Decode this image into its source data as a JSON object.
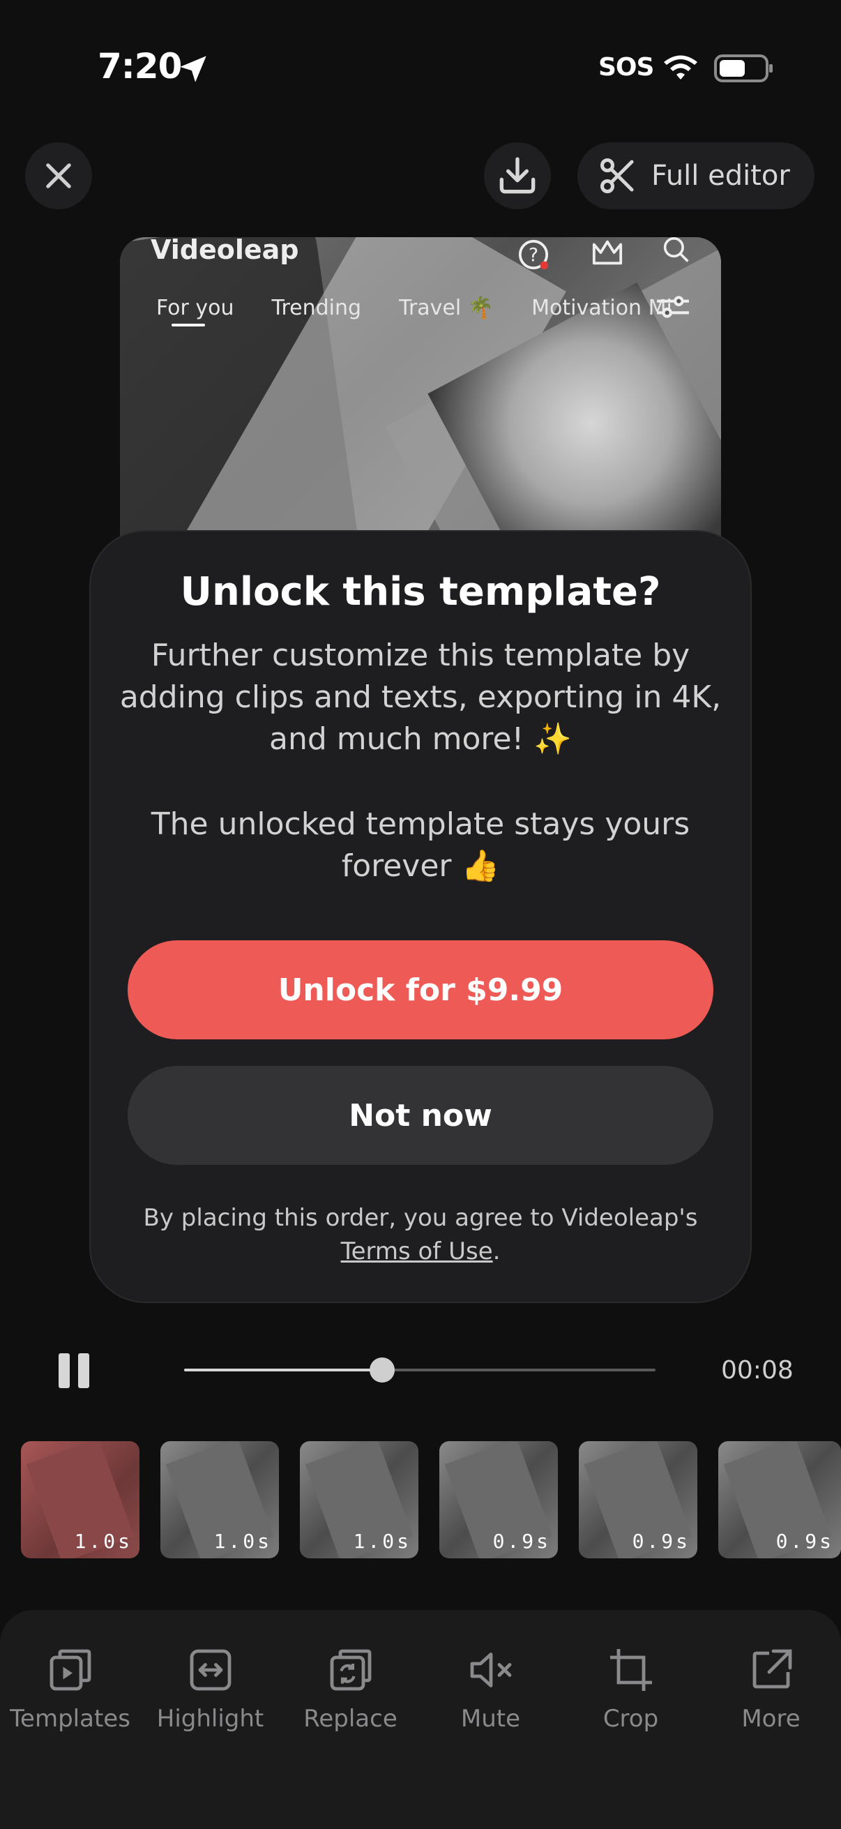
{
  "status": {
    "time": "7:20",
    "sos": "SOS"
  },
  "header": {
    "full_editor_label": "Full editor"
  },
  "preview": {
    "app_name": "Videoleap",
    "tabs": [
      "For you",
      "Trending",
      "Travel 🌴",
      "Motivation Mi"
    ]
  },
  "modal": {
    "title": "Unlock this template?",
    "body": "Further customize this template by adding clips and texts, exporting in 4K, and much more! ✨",
    "body2": "The unlocked template stays yours forever 👍",
    "unlock_label": "Unlock for $9.99",
    "not_now_label": "Not now",
    "legal_prefix": "By placing this order, you agree to Videoleap's",
    "legal_link": "Terms of Use",
    "legal_suffix": "."
  },
  "playback": {
    "time": "00:08",
    "progress": 0.42
  },
  "clips": [
    {
      "duration": "1.0s",
      "selected": true
    },
    {
      "duration": "1.0s"
    },
    {
      "duration": "1.0s"
    },
    {
      "duration": "0.9s"
    },
    {
      "duration": "0.9s"
    },
    {
      "duration": "0.9s"
    }
  ],
  "toolbar": {
    "items": [
      {
        "label": "Templates",
        "icon": "templates-icon"
      },
      {
        "label": "Highlight",
        "icon": "highlight-icon"
      },
      {
        "label": "Replace",
        "icon": "replace-icon"
      },
      {
        "label": "Mute",
        "icon": "mute-icon"
      },
      {
        "label": "Crop",
        "icon": "crop-icon"
      },
      {
        "label": "More",
        "icon": "more-icon"
      }
    ]
  }
}
